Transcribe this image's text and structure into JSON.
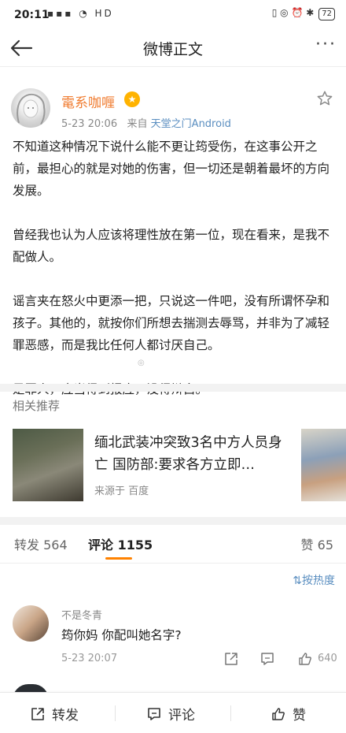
{
  "status_bar": {
    "time": "20:11",
    "battery": "72"
  },
  "nav": {
    "title": "微博正文"
  },
  "post": {
    "username": "電系咖喱",
    "time": "5-23 20:06",
    "source_prefix": "来自",
    "source": "天堂之门Android",
    "paragraphs": [
      "不知道这种情况下说什么能不更让筠受伤，在这事公开之前，最担心的就是对她的伤害，但一切还是朝着最坏的方向发展。",
      "曾经我也认为人应该将理性放在第一位，现在看来，是我不配做人。",
      "谣言夹在怒火中更添一把，只说这一件吧，没有所谓怀孕和孩子。其他的，就按你们所想去揣测去辱骂，并非为了减轻罪恶感，而是我比任何人都讨厌自己。",
      "是罪人，应当得到报应，没得辩白。"
    ]
  },
  "related": {
    "title": "相关推荐",
    "headline": "缅北武装冲突致3名中方人员身亡 国防部:要求各方立即…",
    "source": "来源于 百度"
  },
  "tabs": {
    "repost_label": "转发",
    "repost_count": "564",
    "comment_label": "评论",
    "comment_count": "1155",
    "like_label": "赞",
    "like_count": "65",
    "sort_label": "按热度"
  },
  "comment": {
    "name": "不是冬青",
    "text": "筠你妈  你配叫她名字?",
    "time": "5-23 20:07",
    "likes": "640"
  },
  "bottom_bar": {
    "repost": "转发",
    "comment": "评论",
    "like": "赞"
  },
  "colors": {
    "accent": "#ff8200",
    "username": "#f07c30",
    "link": "#5a8ec0"
  }
}
